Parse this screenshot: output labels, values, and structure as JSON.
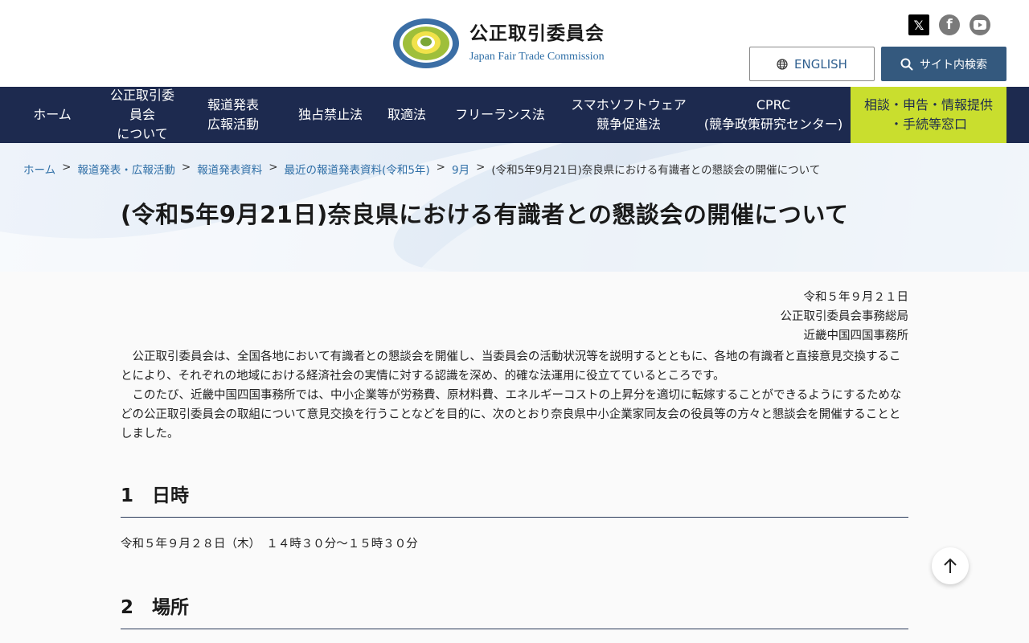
{
  "header": {
    "org_name_ja": "公正取引委員会",
    "org_name_en": "Japan Fair Trade Commission",
    "english_label": "ENGLISH",
    "search_label": "サイト内検索",
    "sns": [
      {
        "name": "x",
        "glyph": "𝕏"
      },
      {
        "name": "facebook",
        "glyph": "f"
      },
      {
        "name": "youtube",
        "glyph": ""
      }
    ]
  },
  "nav": {
    "items": [
      {
        "label": "ホーム"
      },
      {
        "label": "公正取引委員会\nについて"
      },
      {
        "label": "報道発表\n広報活動"
      },
      {
        "label": "独占禁止法"
      },
      {
        "label": "取適法"
      },
      {
        "label": "フリーランス法"
      },
      {
        "label": "スマホソフトウェア\n競争促進法"
      },
      {
        "label": "CPRC\n(競争政策研究センター)"
      },
      {
        "label": "相談・申告・情報提供\n・手続等窓口"
      }
    ]
  },
  "breadcrumb": {
    "items": [
      "ホーム",
      "報道発表・広報活動",
      "報道発表資料",
      "最近の報道発表資料(令和5年)",
      "9月"
    ],
    "current": "(令和5年9月21日)奈良県における有識者との懇談会の開催について",
    "separator": ">"
  },
  "page": {
    "title": "(令和5年9月21日)奈良県における有識者との懇談会の開催について",
    "date": "令和５年９月２１日",
    "issuer1": "公正取引委員会事務総局",
    "issuer2": "近畿中国四国事務所",
    "para1": "　公正取引委員会は、全国各地において有識者との懇談会を開催し、当委員会の活動状況等を説明するとともに、各地の有識者と直接意見交換することにより、それぞれの地域における経済社会の実情に対する認識を深め、的確な法運用に役立てているところです。",
    "para2": "　このたび、近畿中国四国事務所では、中小企業等が労務費、原材料費、エネルギーコストの上昇分を適切に転嫁することができるようにするためなどの公正取引委員会の取組について意見交換を行うことなどを目的に、次のとおり奈良県中小企業家同友会の役員等の方々と懇談会を開催することとしました。",
    "sections": [
      {
        "heading": "1　日時",
        "body": "令和５年９月２８日（木）　１４時３０分～１５時３０分"
      },
      {
        "heading": "2　場所",
        "body": ""
      }
    ]
  },
  "colors": {
    "nav_bg": "#1d2a4f",
    "consult_bg": "#c9de2e",
    "search_btn": "#34597e",
    "link": "#2f6fa7"
  }
}
